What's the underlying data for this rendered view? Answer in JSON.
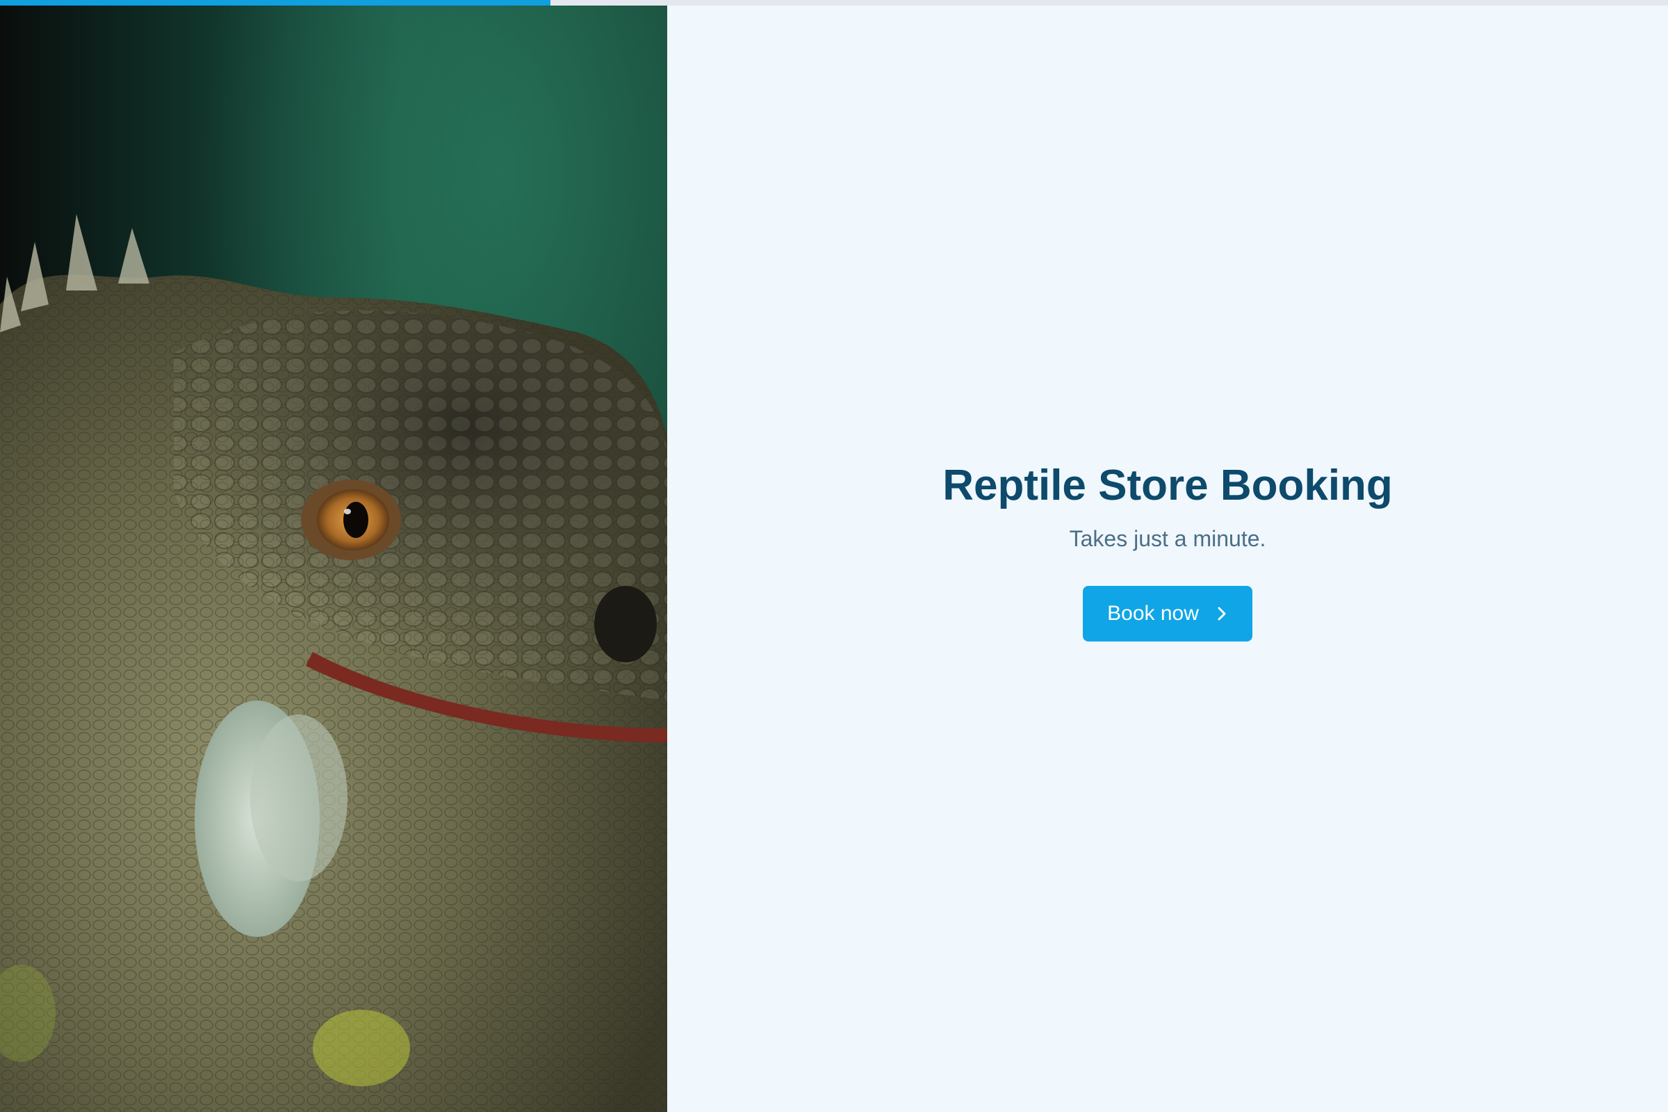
{
  "progress": {
    "fraction": 0.33,
    "track_color": "#e4e8ee",
    "fill_color": "#109fdf"
  },
  "hero": {
    "image": "iguana-closeup-photo"
  },
  "main": {
    "title": "Reptile Store Booking",
    "subtitle": "Takes just a minute.",
    "book_button": {
      "label": "Book now",
      "icon": "chevron-right-icon"
    }
  },
  "colors": {
    "accent": "#10a5e6",
    "title": "#0d4a6b",
    "subtitle": "#4a6f86",
    "background": "#f0f7fd"
  }
}
